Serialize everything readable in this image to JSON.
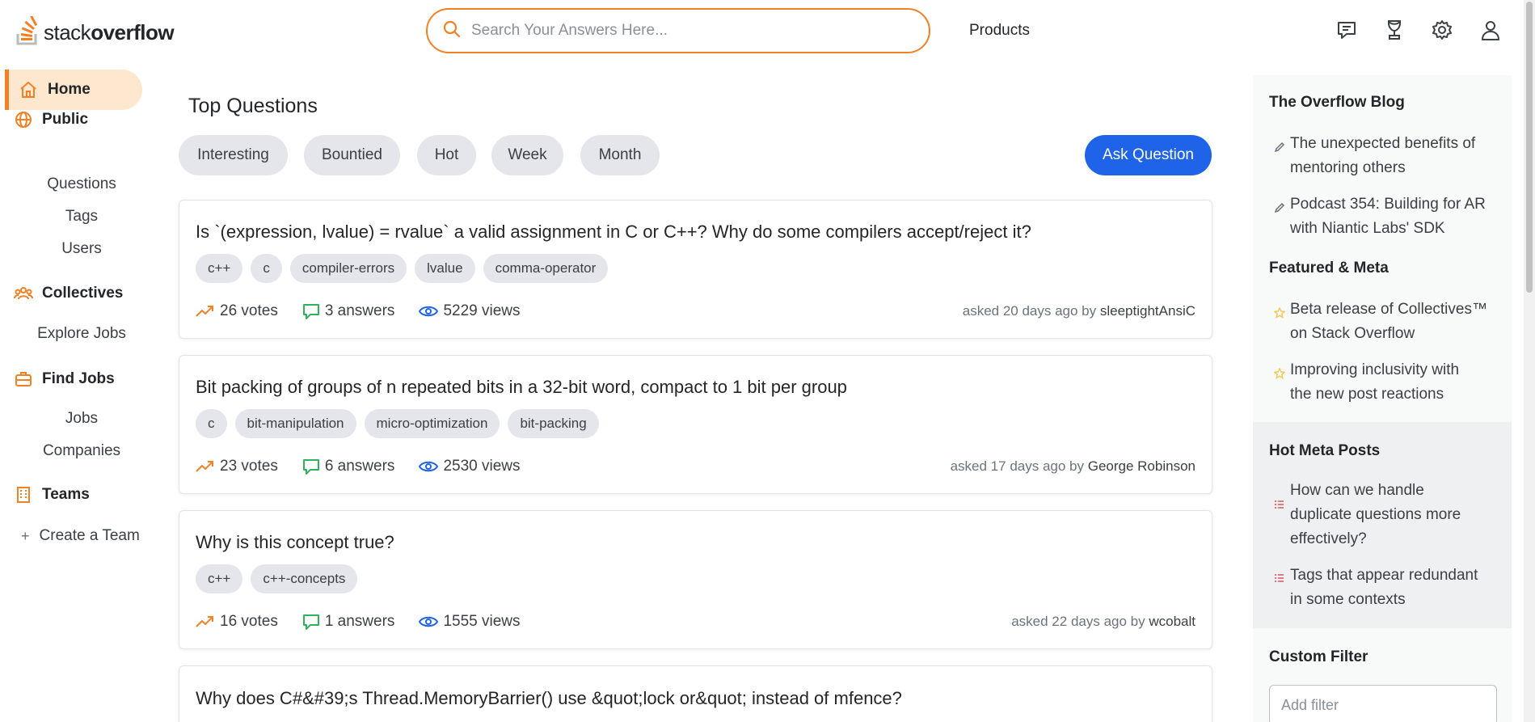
{
  "header": {
    "logo": {
      "part1": "stack",
      "part2": "overflow"
    },
    "search_placeholder": "Search Your Answers Here...",
    "products_label": "Products",
    "icons": [
      "inbox-icon",
      "trophy-icon",
      "gear-icon",
      "user-icon"
    ]
  },
  "sidebar": {
    "home": "Home",
    "public": "Public",
    "questions": "Questions",
    "tags": "Tags",
    "users": "Users",
    "collectives": "Collectives",
    "explore_jobs": "Explore Jobs",
    "find_jobs": "Find Jobs",
    "jobs": "Jobs",
    "companies": "Companies",
    "teams": "Teams",
    "create_team": "Create a Team"
  },
  "main": {
    "title": "Top Questions",
    "filters": [
      "Interesting",
      "Bountied",
      "Hot",
      "Week",
      "Month"
    ],
    "ask_button": "Ask Question",
    "questions": [
      {
        "title": "Is `(expression, lvalue) = rvalue` a valid assignment in C or C++? Why do some compilers accept/reject it?",
        "tags": [
          "c++",
          "c",
          "compiler-errors",
          "lvalue",
          "comma-operator"
        ],
        "votes": "26 votes",
        "answers": "3 answers",
        "views": "5229 views",
        "asked": "asked 20 days ago by",
        "user": "sleeptightAnsiC"
      },
      {
        "title": "Bit packing of groups of n repeated bits in a 32-bit word, compact to 1 bit per group",
        "tags": [
          "c",
          "bit-manipulation",
          "micro-optimization",
          "bit-packing"
        ],
        "votes": "23 votes",
        "answers": "6 answers",
        "views": "2530 views",
        "asked": "asked 17 days ago by",
        "user": "George Robinson"
      },
      {
        "title": "Why is this concept true?",
        "tags": [
          "c++",
          "c++-concepts"
        ],
        "votes": "16 votes",
        "answers": "1 answers",
        "views": "1555 views",
        "asked": "asked 22 days ago by",
        "user": "wcobalt"
      },
      {
        "title": "Why does C#&#39;s Thread.MemoryBarrier() use &quot;lock or&quot; instead of mfence?"
      }
    ]
  },
  "right_panel": {
    "blog_title": "The Overflow Blog",
    "blog_items": [
      [
        "The unexpected benefits of",
        "mentoring others"
      ],
      [
        "Podcast 354: Building for AR",
        "with Niantic Labs' SDK"
      ]
    ],
    "featured_title": "Featured & Meta",
    "featured_items": [
      [
        "Beta release of Collectives™",
        "on Stack Overflow"
      ],
      [
        "Improving inclusivity with",
        "the new post reactions"
      ]
    ],
    "hot_meta_title": "Hot Meta Posts",
    "hot_meta_items": [
      [
        "How can we handle",
        "duplicate questions more",
        "effectively?"
      ],
      [
        "Tags that appear redundant",
        "in some contexts"
      ]
    ],
    "custom_filter_title": "Custom Filter",
    "add_filter_placeholder": "Add filter"
  },
  "colors": {
    "accent": "#f48024",
    "primary_button": "#1f64e8",
    "tag_bg": "#e4e6eb",
    "answers_green": "#2fb35a",
    "views_blue": "#1f64e8",
    "star_yellow": "#f2c94c",
    "meta_red": "#e0465a"
  }
}
